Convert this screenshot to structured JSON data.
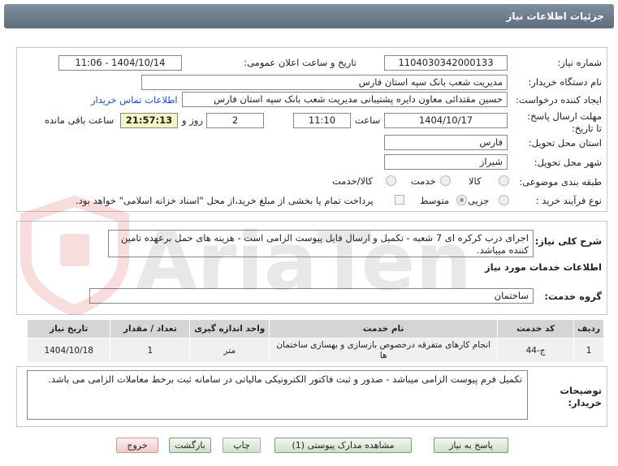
{
  "header": {
    "title": "جزئیات اطلاعات نیاز"
  },
  "form": {
    "need_number_label": "شماره نیاز:",
    "need_number": "1104030342000133",
    "announce_label": "تاریخ و ساعت اعلان عمومی:",
    "announce_value": "1404/10/14 - 11:06",
    "buyer_org_label": "نام دستگاه خریدار:",
    "buyer_org": "مدیریت شعب بانک سپه استان فارس",
    "creator_label": "ایجاد کننده درخواست:",
    "creator": "حسین مقتدائی معاون  دایره پشتیبانی مدیریت شعب بانک سپه استان فارس",
    "contact_link": "اطلاعات تماس خریدار",
    "deadline_label": "مهلت ارسال پاسخ: تا تاریخ:",
    "deadline_date": "1404/10/17",
    "time_label": "ساعت",
    "deadline_time": "11:10",
    "days_value": "2",
    "days_label": "روز و",
    "remaining_time": "21:57:13",
    "remaining_label": "ساعت باقی مانده",
    "province_label": "استان محل تحویل:",
    "province": "فارس",
    "city_label": "شهر محل تحویل:",
    "city": "شیراز",
    "category_label": "طبقه بندی موضوعی:",
    "category_options": [
      "کالا",
      "خدمت",
      "کالا/خدمت"
    ],
    "category_selected": "خدمت",
    "process_label": "نوع فرآیند خرید :",
    "process_options": [
      "جزیی",
      "متوسط"
    ],
    "process_selected": "جزیی",
    "payment_note": "پرداخت تمام یا بخشی از مبلغ خرید،از محل \"اسناد خزانه اسلامی\" خواهد بود."
  },
  "summary": {
    "label": "شرح کلی نیاز:",
    "text": "اجرای درب کرکره ای 7 شعبه - تکمیل و ارسال فایل پیوست الزامی است - هزینه های حمل برعهده تامین کننده میباشد."
  },
  "services": {
    "section_title": "اطلاعات خدمات مورد نیاز",
    "group_label": "گروه خدمت:",
    "group_value": "ساختمان",
    "columns": [
      "ردیف",
      "کد خدمت",
      "نام خدمت",
      "واحد اندازه گیری",
      "تعداد / مقدار",
      "تاریخ نیاز"
    ],
    "rows": [
      {
        "row": "1",
        "code": "ج-44",
        "name": "انجام کارهای متفرقه درخصوص بازسازی و بهسازی ساختمان ها",
        "unit": "متر",
        "qty": "1",
        "date": "1404/10/18"
      }
    ]
  },
  "buyer_notes": {
    "label": "توضیحات خریدار:",
    "text": "تکمیل فرم پیوست الزامی میباشد - صدور و ثبت فاکتور الکترونیکی مالیاتی در سامانه ثبت برخط معاملات الزامی می باشد."
  },
  "buttons": {
    "reply": "پاسخ به نیاز",
    "docs": "مشاهده مدارک پیوستی (1)",
    "print": "چاپ",
    "back": "بازگشت",
    "exit": "خروج"
  },
  "watermark": {
    "text": "AriaTender.net"
  },
  "colors": {
    "header": "#6b7b8c",
    "link": "#1a4fc4",
    "remaining_bg": "#f5f5c6"
  }
}
